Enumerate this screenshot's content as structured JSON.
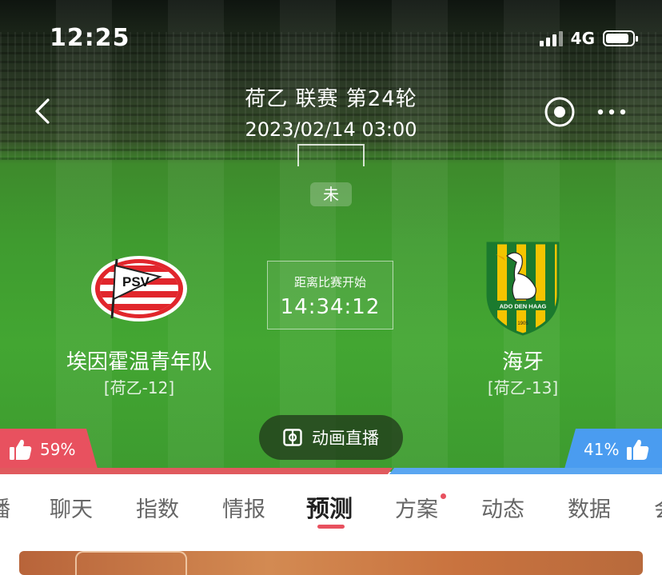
{
  "status_bar": {
    "time": "12:25",
    "network": "4G"
  },
  "header": {
    "league_round": "荷乙 联赛 第24轮",
    "datetime": "2023/02/14 03:00",
    "match_state": "未"
  },
  "match": {
    "home": {
      "name": "埃因霍温青年队",
      "rank": "[荷乙-12]",
      "logo_text": "PSV"
    },
    "away": {
      "name": "海牙",
      "rank": "[荷乙-13]",
      "logo_text": "ADO DEN HAAG",
      "logo_year": "1905"
    },
    "countdown_label": "距离比赛开始",
    "countdown_time": "14:34:12"
  },
  "live_button": {
    "label": "动画直播"
  },
  "vote": {
    "home_percent": "59%",
    "away_percent": "41%",
    "home_share": 0.59,
    "home_color": "#e8515f",
    "away_color": "#4a9cf0"
  },
  "tabs": [
    {
      "label": "播"
    },
    {
      "label": "聊天"
    },
    {
      "label": "指数"
    },
    {
      "label": "情报"
    },
    {
      "label": "预测",
      "active": true
    },
    {
      "label": "方案",
      "badge_dot": true
    },
    {
      "label": "动态"
    },
    {
      "label": "数据"
    },
    {
      "label": "会"
    }
  ],
  "icons": [
    "back-arrow-icon",
    "target-icon",
    "more-icon",
    "live-animation-icon",
    "thumbs-up-icon"
  ]
}
